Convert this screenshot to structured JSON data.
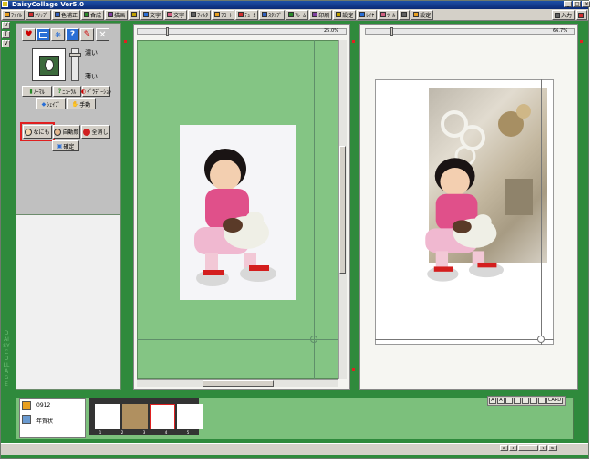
{
  "window": {
    "title": "DaisyCollage Ver5.0"
  },
  "toolbar": {
    "items": [
      {
        "label": "ﾌｧｲﾙ",
        "icon": "folder-icon"
      },
      {
        "label": "ｸﾘｯﾌﾟ",
        "icon": "heart-clip-icon"
      },
      {
        "label": "色補正",
        "icon": "color-correct-icon"
      },
      {
        "label": "合成",
        "icon": "merge-icon"
      },
      {
        "label": "描画",
        "icon": "pencil-icon"
      },
      {
        "label": "",
        "icon": "frame-icon"
      },
      {
        "label": "文字",
        "icon": "text-icon"
      },
      {
        "label": "文字",
        "icon": "text-style-icon"
      },
      {
        "label": "ﾌｨﾙﾀ",
        "icon": "filter-icon"
      },
      {
        "label": "ﾌﾛｰﾄ",
        "icon": "float-icon"
      },
      {
        "label": "ﾃｭｰｸ",
        "icon": "tool-icon"
      },
      {
        "label": "ｽﾀﾝﾌﾟ",
        "icon": "stamp-icon"
      },
      {
        "label": "ﾌﾚｰﾑ",
        "icon": "frame-border-icon"
      },
      {
        "label": "印刷",
        "icon": "print-icon"
      },
      {
        "label": "設定",
        "icon": "settings-icon"
      },
      {
        "label": "ﾚｲﾔ",
        "icon": "layer-icon"
      },
      {
        "label": "ﾂｰﾙ",
        "icon": "tools-icon"
      },
      {
        "label": "",
        "icon": "view-icon"
      },
      {
        "label": "設定",
        "icon": "gear-icon"
      }
    ],
    "right": [
      {
        "label": "入力",
        "icon": "input-icon"
      },
      {
        "label": "",
        "icon": "exit-icon"
      }
    ]
  },
  "leftstrip": {
    "buttons": [
      "V",
      "T",
      "V"
    ],
    "vertical_text": "DAISY COLLAGE"
  },
  "leftpanel": {
    "density_high": "濃い",
    "density_low": "薄い",
    "btn_normal": "ﾉｰﾏﾙ",
    "btn_blur": "ﾆｭｰﾗﾙ",
    "btn_gradient": "ｸﾞﾗﾃﾞｰｼｮﾝ",
    "btn_shape": "ｼｪｲﾌﾟ",
    "btn_manual": "手動",
    "btn_none": "なにも",
    "btn_auto": "自動顔",
    "btn_clear": "全消し",
    "btn_confirm": "確定"
  },
  "editor": {
    "zoom": "25.0%"
  },
  "preview": {
    "zoom": "66.7%"
  },
  "filmstrip": {
    "item_number": "0912",
    "item_name": "年賀状",
    "frame_labels": [
      "1",
      "2",
      "3",
      "4",
      "5"
    ]
  },
  "bottom_icons": [
    "A",
    "A",
    "",
    "",
    "",
    "",
    "",
    "CARD"
  ],
  "colors": {
    "app_green": "#2f8a3c",
    "canvas_green": "#84c584",
    "highlight_red": "#e02020"
  }
}
